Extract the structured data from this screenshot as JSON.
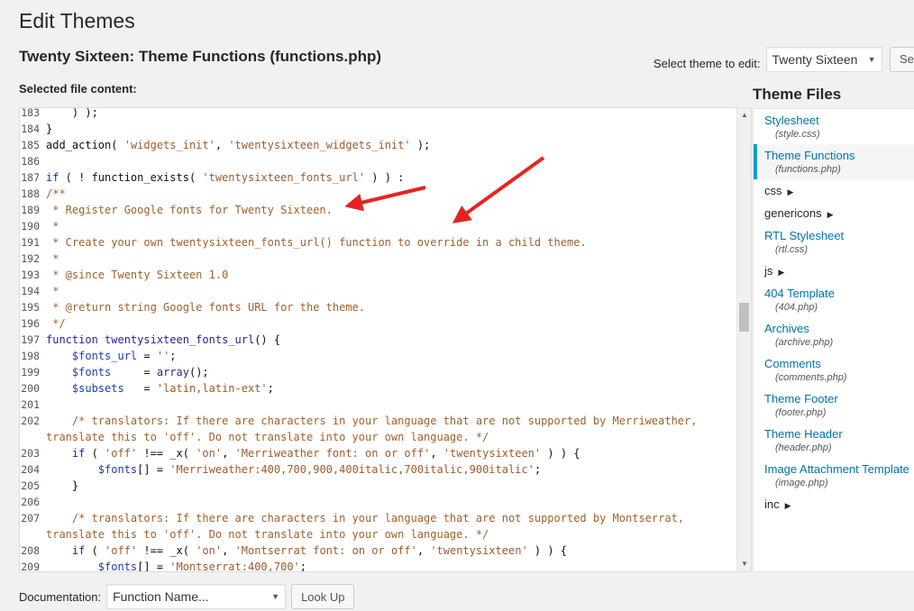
{
  "header": {
    "page_title": "Edit Themes",
    "file_title": "Twenty Sixteen: Theme Functions (functions.php)"
  },
  "theme_select": {
    "label": "Select theme to edit:",
    "value": "Twenty Sixteen",
    "button": "Sel"
  },
  "editor": {
    "label": "Selected file content:",
    "lines": [
      {
        "n": "183",
        "html": "    ) );"
      },
      {
        "n": "184",
        "html": "}"
      },
      {
        "n": "185",
        "html": "add_action( <span class=\"c-str\">'widgets_init'</span>, <span class=\"c-str\">'twentysixteen_widgets_init'</span> );"
      },
      {
        "n": "186",
        "html": ""
      },
      {
        "n": "187",
        "html": "<span class=\"c-kw\">if</span> ( ! function_exists( <span class=\"c-str\">'twentysixteen_fonts_url'</span> ) ) :"
      },
      {
        "n": "188",
        "html": "<span class=\"c-comment\">/**</span>"
      },
      {
        "n": "189",
        "html": "<span class=\"c-comment\"> * Register Google fonts for Twenty Sixteen.</span>"
      },
      {
        "n": "190",
        "html": "<span class=\"c-comment\"> *</span>"
      },
      {
        "n": "191",
        "html": "<span class=\"c-comment\"> * Create your own twentysixteen_fonts_url() function to override in a child theme.</span>"
      },
      {
        "n": "192",
        "html": "<span class=\"c-comment\"> *</span>"
      },
      {
        "n": "193",
        "html": "<span class=\"c-comment\"> * @since Twenty Sixteen 1.0</span>"
      },
      {
        "n": "194",
        "html": "<span class=\"c-comment\"> *</span>"
      },
      {
        "n": "195",
        "html": "<span class=\"c-comment\"> * @return string Google fonts URL for the theme.</span>"
      },
      {
        "n": "196",
        "html": "<span class=\"c-comment\"> */</span>"
      },
      {
        "n": "197",
        "html": "<span class=\"c-kw\">function</span> <span class=\"c-kw\">twentysixteen_fonts_url</span>() {"
      },
      {
        "n": "198",
        "html": "    <span class=\"c-var\">$fonts_url</span> = <span class=\"c-str\">''</span>;"
      },
      {
        "n": "199",
        "html": "    <span class=\"c-var\">$fonts</span>     = <span class=\"c-kw\">array</span>();"
      },
      {
        "n": "200",
        "html": "    <span class=\"c-var\">$subsets</span>   = <span class=\"c-str\">'latin,latin-ext'</span>;"
      },
      {
        "n": "201",
        "html": ""
      },
      {
        "n": "202",
        "html": "    <span class=\"c-comment\">/* translators: If there are characters in your language that are not supported by Merriweather,</span>"
      },
      {
        "n": "",
        "html": "<span class=\"c-comment\">translate this to 'off'. Do not translate into your own language. */</span>"
      },
      {
        "n": "203",
        "html": "    <span class=\"c-kw\">if</span> ( <span class=\"c-str\">'off'</span> !== _x( <span class=\"c-str\">'on'</span>, <span class=\"c-str\">'Merriweather font: on or off'</span>, <span class=\"c-str\">'twentysixteen'</span> ) ) {"
      },
      {
        "n": "204",
        "html": "        <span class=\"c-var\">$fonts</span>[] = <span class=\"c-str\">'Merriweather:400,700,900,400italic,700italic,900italic'</span>;"
      },
      {
        "n": "205",
        "html": "    }"
      },
      {
        "n": "206",
        "html": ""
      },
      {
        "n": "207",
        "html": "    <span class=\"c-comment\">/* translators: If there are characters in your language that are not supported by Montserrat,</span>"
      },
      {
        "n": "",
        "html": "<span class=\"c-comment\">translate this to 'off'. Do not translate into your own language. */</span>"
      },
      {
        "n": "208",
        "html": "    <span class=\"c-kw\">if</span> ( <span class=\"c-str\">'off'</span> !== _x( <span class=\"c-str\">'on'</span>, <span class=\"c-str\">'Montserrat font: on or off'</span>, <span class=\"c-str\">'twentysixteen'</span> ) ) {"
      },
      {
        "n": "209",
        "html": "        <span class=\"c-var\">$fonts</span>[] = <span class=\"c-str\">'Montserrat:400,700'</span>;"
      },
      {
        "n": "210",
        "html": "    }"
      }
    ]
  },
  "sidebar": {
    "title": "Theme Files",
    "items": [
      {
        "type": "file",
        "name": "Stylesheet",
        "file": "(style.css)"
      },
      {
        "type": "file",
        "name": "Theme Functions",
        "file": "(functions.php)",
        "current": true
      },
      {
        "type": "folder",
        "name": "css"
      },
      {
        "type": "folder",
        "name": "genericons"
      },
      {
        "type": "file",
        "name": "RTL Stylesheet",
        "file": "(rtl.css)"
      },
      {
        "type": "folder",
        "name": "js"
      },
      {
        "type": "file",
        "name": "404 Template",
        "file": "(404.php)"
      },
      {
        "type": "file",
        "name": "Archives",
        "file": "(archive.php)"
      },
      {
        "type": "file",
        "name": "Comments",
        "file": "(comments.php)"
      },
      {
        "type": "file",
        "name": "Theme Footer",
        "file": "(footer.php)"
      },
      {
        "type": "file",
        "name": "Theme Header",
        "file": "(header.php)"
      },
      {
        "type": "file",
        "name": "Image Attachment Template",
        "file": "(image.php)"
      },
      {
        "type": "folder",
        "name": "inc"
      }
    ]
  },
  "footer": {
    "doc_label": "Documentation:",
    "doc_placeholder": "Function Name...",
    "lookup_button": "Look Up"
  },
  "colors": {
    "accent": "#0073aa",
    "current_bar": "#00a0d2",
    "annotation_arrow": "#e8231f"
  }
}
